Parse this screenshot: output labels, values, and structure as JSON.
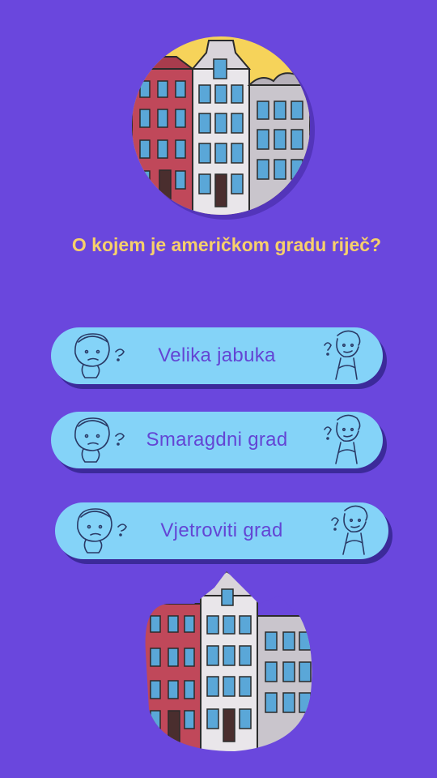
{
  "question": {
    "text": "O kojem je američkom gradu riječ?"
  },
  "options": [
    {
      "label": "Velika jabuka"
    },
    {
      "label": "Smaragdni grad"
    },
    {
      "label": "Vjetroviti grad"
    }
  ],
  "colors": {
    "background": "#6a47dd",
    "question_text": "#f7d06b",
    "option_fill": "#84d3f8",
    "option_text": "#6345d4",
    "option_shadow": "#3c2a9a"
  },
  "icons": [
    "buildings-illustration",
    "thinking-boy-icon",
    "thinking-kid-icon"
  ]
}
